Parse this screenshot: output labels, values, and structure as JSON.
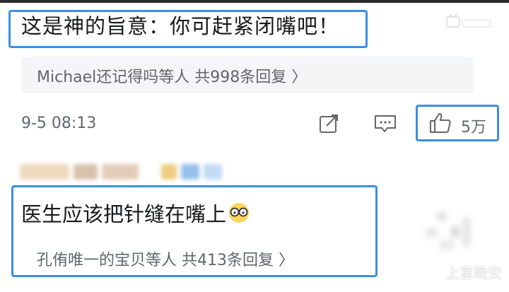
{
  "comment_1": {
    "text": "这是神的旨意：你可赶紧闭嘴吧！",
    "replies_summary": "Michael还记得吗等人  共998条回复  〉",
    "timestamp": "9-5 08:13",
    "like_count": "5万",
    "icons": [
      "share-icon",
      "reply-icon",
      "thumbs-up-icon"
    ]
  },
  "comment_2": {
    "text": "医生应该把针缝在嘴上",
    "emoji": "glasses-emoji",
    "replies_summary": "孔侑唯一的宝贝等人  共413条回复  〉"
  },
  "watermark": {
    "bottom_right": "上官晚安"
  },
  "colors": {
    "highlight_border": "#3a8ee6",
    "reply_panel_bg": "#f4f5f7",
    "secondary_text": "#61666d",
    "primary_text": "#18191c"
  }
}
